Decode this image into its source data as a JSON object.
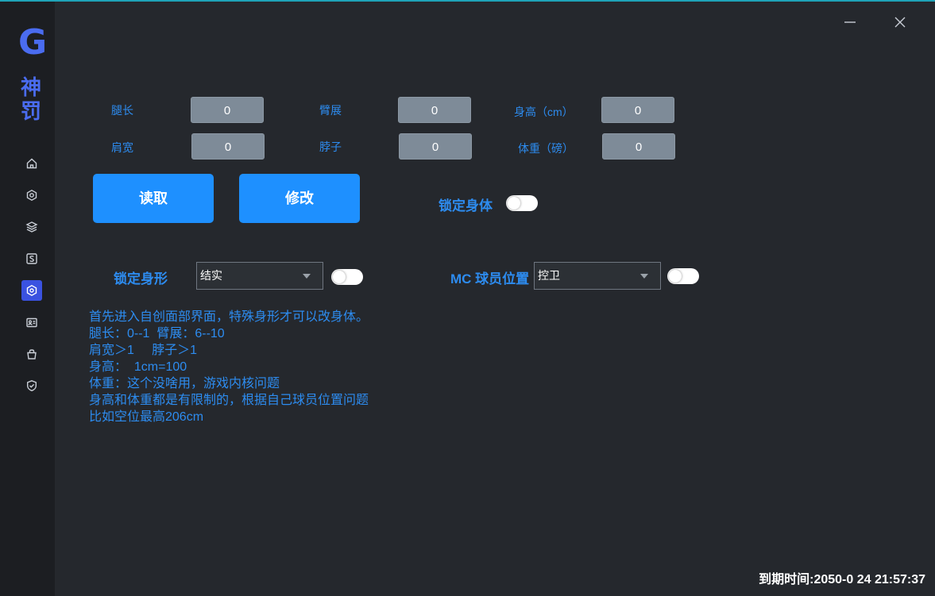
{
  "app": {
    "logo_letter": "G",
    "logo_text_line1": "神",
    "logo_text_line2": "罚",
    "brand_color": "#4a6cf0",
    "accent_color": "#1e90ff"
  },
  "sidebar": {
    "items": [
      {
        "icon": "home-icon"
      },
      {
        "icon": "gear-hexagon-icon"
      },
      {
        "icon": "layers-icon"
      },
      {
        "icon": "s-box-icon"
      },
      {
        "icon": "hexagon-target-icon",
        "active": true
      },
      {
        "icon": "id-card-icon"
      },
      {
        "icon": "basket-icon"
      },
      {
        "icon": "shield-check-icon"
      }
    ]
  },
  "window": {
    "minimize_icon": "minimize-icon",
    "close_icon": "close-icon"
  },
  "fields": {
    "leg_length": {
      "label": "腿长",
      "value": "0"
    },
    "arm_span": {
      "label": "臂展",
      "value": "0"
    },
    "height": {
      "label": "身高（cm）",
      "value": "0"
    },
    "shoulder_width": {
      "label": "肩宽",
      "value": "0"
    },
    "neck": {
      "label": "脖子",
      "value": "0"
    },
    "weight": {
      "label": "体重（磅）",
      "value": "0"
    }
  },
  "buttons": {
    "read": "读取",
    "modify": "修改"
  },
  "lock_body": {
    "label": "锁定身体",
    "on": false
  },
  "lock_shape": {
    "label": "锁定身形",
    "selected": "结实",
    "on": false
  },
  "mc_position": {
    "label": "MC 球员位置",
    "selected": "控卫",
    "on": false
  },
  "notes": [
    "首先进入自创面部界面，特殊身形才可以改身体。",
    "腿长：0--1  臂展：6--10",
    "肩宽＞1     脖子＞1",
    "身高：  1cm=100",
    "体重：这个没啥用，游戏内核问题",
    "身高和体重都是有限制的，根据自己球员位置问题",
    "比如空位最高206cm"
  ],
  "expiry": "到期时间:2050-0   24 21:57:37"
}
